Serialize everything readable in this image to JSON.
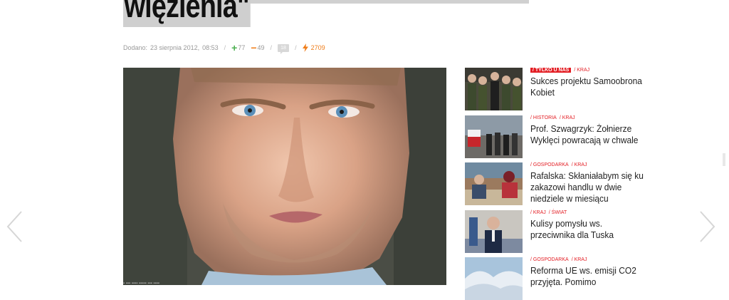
{
  "article": {
    "headline": "więzienia\"",
    "meta": {
      "added_label": "Dodano:",
      "date": "23 sierpnia 2012,",
      "time": "08:53",
      "plus": "77",
      "minus": "49",
      "comments": "18",
      "views": "2709"
    }
  },
  "sidebar": {
    "items": [
      {
        "tags": [
          "/ TYLKO U NAS",
          "/ KRAJ"
        ],
        "highlight_first": true,
        "title": "Sukces projektu Samoobrona Kobiet"
      },
      {
        "tags": [
          "/ HISTORIA",
          "/ KRAJ"
        ],
        "highlight_first": false,
        "title": "Prof. Szwagrzyk: Żołnierze Wyklęci powracają w chwale"
      },
      {
        "tags": [
          "/ GOSPODARKA",
          "/ KRAJ"
        ],
        "highlight_first": false,
        "title": "Rafalska: Skłaniałabym się ku zakazowi handlu w dwie niedziele w miesiącu"
      },
      {
        "tags": [
          "/ KRAJ",
          "/ ŚWIAT"
        ],
        "highlight_first": false,
        "title": "Kulisy pomysłu ws. przeciwnika dla Tuska"
      },
      {
        "tags": [
          "/ GOSPODARKA",
          "/ KRAJ"
        ],
        "highlight_first": false,
        "title": "Reforma UE ws. emisji CO2 przyjęta. Pomimo"
      }
    ]
  },
  "colors": {
    "accent": "#e31e24",
    "positive": "#4caf50",
    "negative": "#ef7d19"
  },
  "icons": [
    "plus-icon",
    "minus-icon",
    "comment-icon",
    "bolt-icon",
    "chevron-left-icon",
    "chevron-right-icon"
  ]
}
